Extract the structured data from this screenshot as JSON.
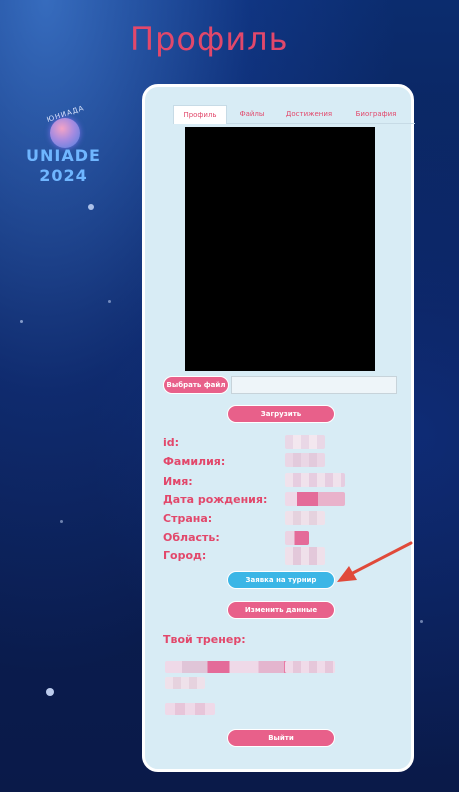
{
  "page": {
    "title": "Профиль"
  },
  "logo": {
    "arc_text": "ЮНИАДА",
    "word": "UNIADE",
    "year": "2024"
  },
  "tabs": [
    {
      "label": "Профиль",
      "active": true
    },
    {
      "label": "Файлы",
      "active": false
    },
    {
      "label": "Достижения",
      "active": false
    },
    {
      "label": "Биография",
      "active": false
    }
  ],
  "upload": {
    "choose_label": "Выбрать файл",
    "upload_label": "Загрузить"
  },
  "fields": {
    "id": "id:",
    "surname": "Фамилия:",
    "name": "Имя:",
    "birth_date": "Дата рождения:",
    "country": "Страна:",
    "region": "Область:",
    "city": "Город:"
  },
  "actions": {
    "tournament_label": "Заявка на турнир",
    "edit_label": "Изменить данные",
    "logout_label": "Выйти"
  },
  "trainer": {
    "heading": "Твой тренер:"
  },
  "colors": {
    "accent": "#e2486b",
    "button": "#e8608a",
    "tournament_button": "#3bb6e6",
    "card": "#d8ecf5"
  }
}
